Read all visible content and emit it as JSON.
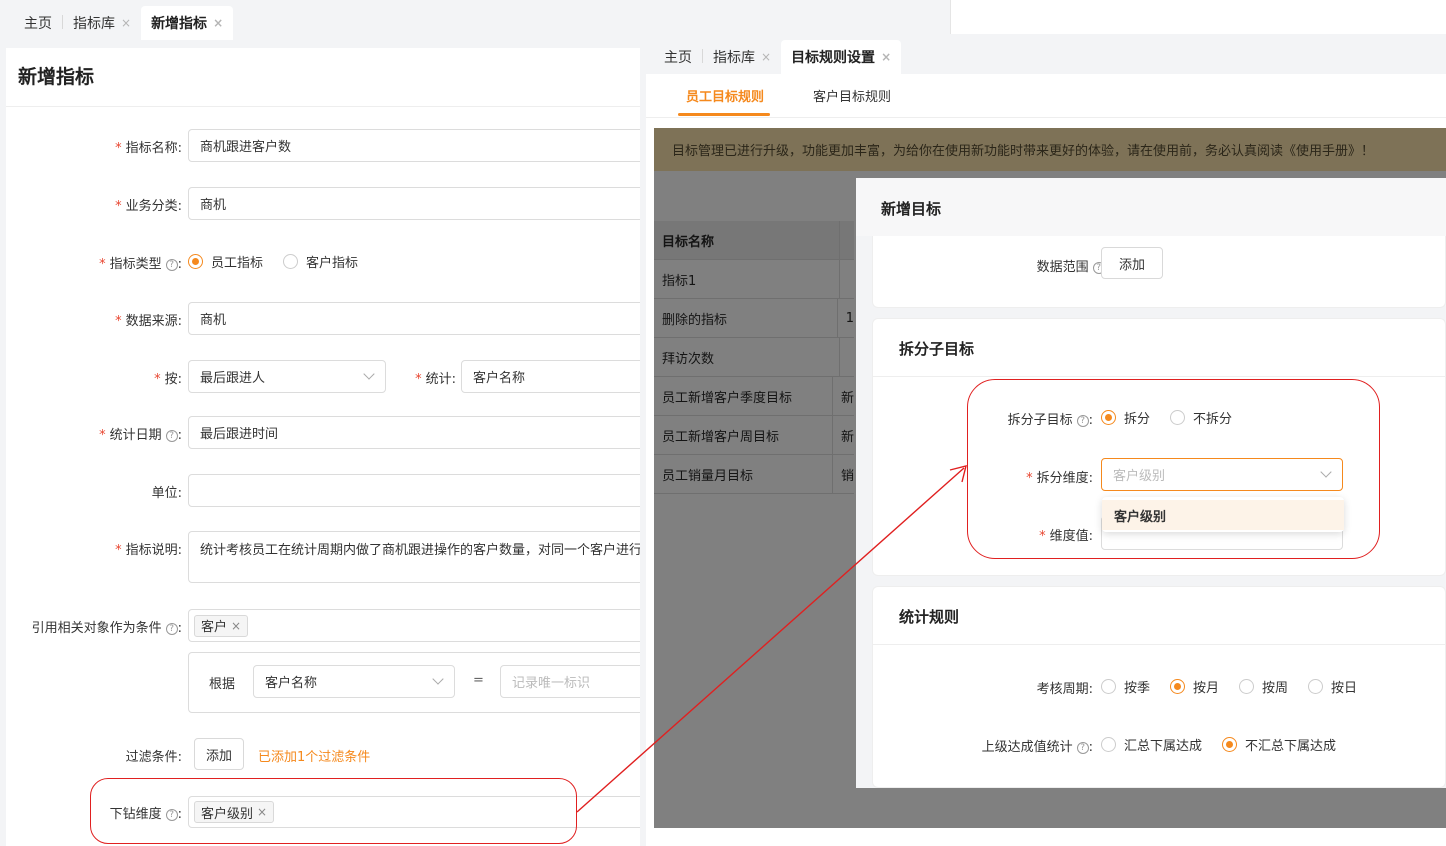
{
  "left": {
    "tabs": [
      {
        "label": "主页"
      },
      {
        "label": "指标库"
      },
      {
        "label": "新增指标"
      }
    ],
    "page_title": "新增指标",
    "form": {
      "name_label": "指标名称",
      "name_value": "商机跟进客户数",
      "category_label": "业务分类",
      "category_value": "商机",
      "type_label": "指标类型",
      "type_options": [
        "员工指标",
        "客户指标"
      ],
      "type_selected": "员工指标",
      "source_label": "数据来源",
      "source_value": "商机",
      "by_label": "按",
      "by_value": "最后跟进人",
      "stat_label": "统计",
      "stat_value": "客户名称",
      "date_label": "统计日期",
      "date_value": "最后跟进时间",
      "unit_label": "单位",
      "unit_value": "",
      "desc_label": "指标说明",
      "desc_value": "统计考核员工在统计周期内做了商机跟进操作的客户数量，对同一个客户进行",
      "ref_label": "引用相关对象作为条件",
      "ref_tag": "客户",
      "basis_label": "根据",
      "basis_value": "客户名称",
      "equals": "=",
      "unique_placeholder": "记录唯一标识",
      "filter_label": "过滤条件",
      "filter_button": "添加",
      "filter_status": "已添加1个过滤条件",
      "drill_label": "下钻维度",
      "drill_tag": "客户级别"
    }
  },
  "right": {
    "tabs": [
      {
        "label": "主页"
      },
      {
        "label": "指标库"
      },
      {
        "label": "目标规则设置"
      }
    ],
    "subtabs": [
      "员工目标规则",
      "客户目标规则"
    ],
    "notice": "目标管理已进行升级，功能更加丰富，为给你在使用新功能时带来更好的体验，请在使用前，务必认真阅读《使用手册》！",
    "table": {
      "header": "目标名称",
      "rows": [
        "指标1",
        "删除的指标",
        "拜访次数",
        "员工新增客户季度目标",
        "员工新增客户周目标",
        "员工销量月目标"
      ],
      "col2_partial": [
        "",
        "1",
        "",
        "新",
        "新",
        "销"
      ]
    }
  },
  "drawer": {
    "title": "新增目标",
    "data_range_label": "数据范围",
    "data_range_button": "添加",
    "split_section_title": "拆分子目标",
    "split_label": "拆分子目标",
    "split_options": [
      "拆分",
      "不拆分"
    ],
    "split_selected": "拆分",
    "split_dim_label": "拆分维度",
    "split_dim_placeholder": "客户级别",
    "dim_value_label": "维度值",
    "dropdown_option": "客户级别",
    "stats_section_title": "统计规则",
    "period_label": "考核周期",
    "period_options": [
      "按季",
      "按月",
      "按周",
      "按日"
    ],
    "period_selected": "按月",
    "upper_label": "上级达成值统计",
    "upper_options": [
      "汇总下属达成",
      "不汇总下属达成"
    ],
    "upper_selected": "不汇总下属达成"
  },
  "colors": {
    "accent": "#f5891d",
    "required": "#e8442f",
    "highlight": "#e02020"
  }
}
